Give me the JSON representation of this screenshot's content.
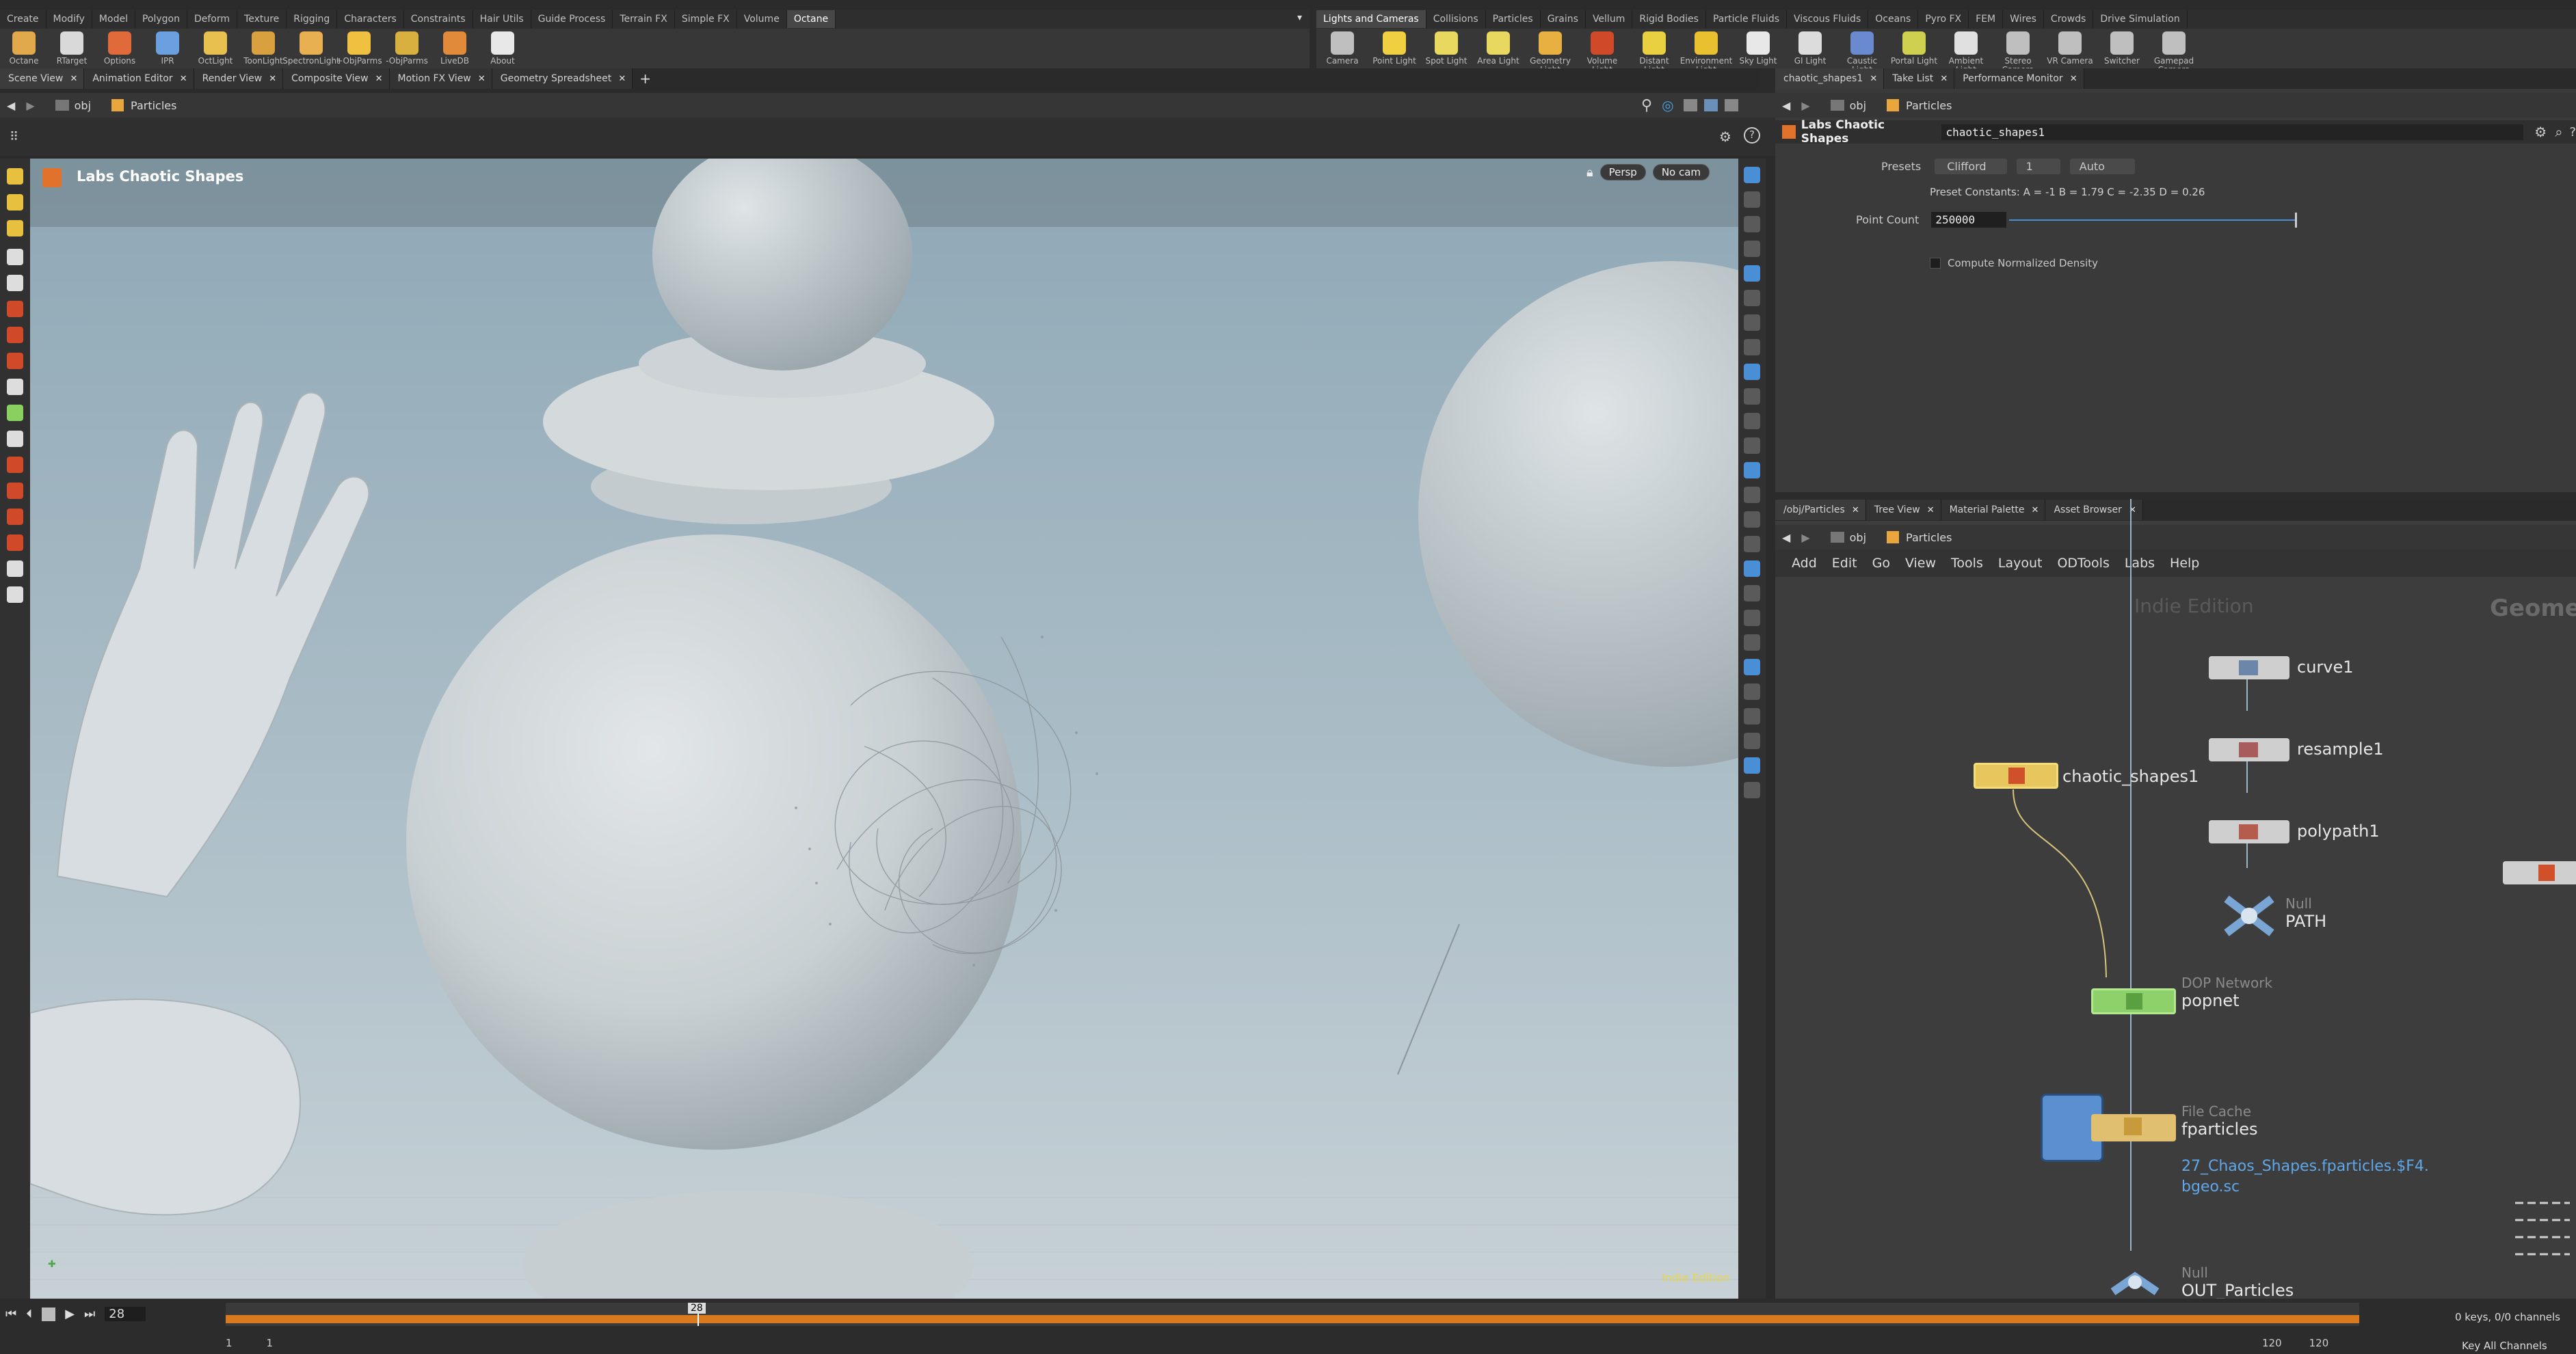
{
  "shelf_tabs_left": [
    "Create",
    "Modify",
    "Model",
    "Polygon",
    "Deform",
    "Texture",
    "Rigging",
    "Characters",
    "Constraints",
    "Hair Utils",
    "Guide Process",
    "Terrain FX",
    "Simple FX",
    "Volume",
    "Octane"
  ],
  "shelf_tabs_right": [
    "Lights and Cameras",
    "Collisions",
    "Particles",
    "Grains",
    "Vellum",
    "Rigid Bodies",
    "Particle Fluids",
    "Viscous Fluids",
    "Oceans",
    "Pyro FX",
    "FEM",
    "Wires",
    "Crowds",
    "Drive Simulation"
  ],
  "tools_left": [
    "Octane",
    "RTarget",
    "Options",
    "IPR",
    "OctLight",
    "ToonLight",
    "SpectronLight",
    "+ObjParms",
    "-ObjParms",
    "LiveDB",
    "About"
  ],
  "tools_right": [
    "Camera",
    "Point Light",
    "Spot Light",
    "Area Light",
    "Geometry Light",
    "Volume Light",
    "Distant Light",
    "Environment Light",
    "Sky Light",
    "GI Light",
    "Caustic Light",
    "Portal Light",
    "Ambient Light",
    "Stereo Camera",
    "VR Camera",
    "Switcher",
    "Gamepad Camera"
  ],
  "view_tabs": [
    "Scene View",
    "Animation Editor",
    "Render View",
    "Composite View",
    "Motion FX View",
    "Geometry Spreadsheet"
  ],
  "path": {
    "obj": "obj",
    "node": "Particles"
  },
  "viewport": {
    "title": "Labs Chaotic Shapes",
    "persp": "Persp",
    "cam": "No cam",
    "watermark": "Indie Edition"
  },
  "params": {
    "tabs": [
      "chaotic_shapes1",
      "Take List",
      "Performance Monitor"
    ],
    "node_type": "Labs Chaotic Shapes",
    "node_name": "chaotic_shapes1",
    "presets_label": "Presets",
    "preset_value": "Clifford",
    "preset_num": "1",
    "preset_mode": "Auto",
    "constants": "Preset Constants:  A = -1  B = 1.79  C = -2.35  D = 0.26",
    "point_count_label": "Point Count",
    "point_count": "250000",
    "normalized": "Compute Normalized Density"
  },
  "network": {
    "tabs": [
      "/obj/Particles",
      "Tree View",
      "Material Palette",
      "Asset Browser"
    ],
    "menu": [
      "Add",
      "Edit",
      "Go",
      "View",
      "Tools",
      "Layout",
      "ODTools",
      "Labs",
      "Help"
    ],
    "watermark": "Indie Edition",
    "right_label": "Geomet",
    "nodes": {
      "curve": "curve1",
      "resample": "resample1",
      "polypath": "polypath1",
      "null_type": "Null",
      "null_name": "PATH",
      "chaotic": "chaotic_shapes1",
      "dop_type": "DOP Network",
      "dop_name": "popnet",
      "cache_type": "File Cache",
      "cache_name": "fparticles",
      "cache_file": "27_Chaos_Shapes.fparticles.$F4.bgeo.sc",
      "out_type": "Null",
      "out_name": "OUT_Particles"
    }
  },
  "timeline": {
    "frame": "28",
    "start": "1",
    "end": "120",
    "range_start": "1",
    "range_in": "1",
    "range_out": "120",
    "range_end": "120",
    "keys": "0 keys, 0/0 channels",
    "key_all": "Key All Channels"
  }
}
